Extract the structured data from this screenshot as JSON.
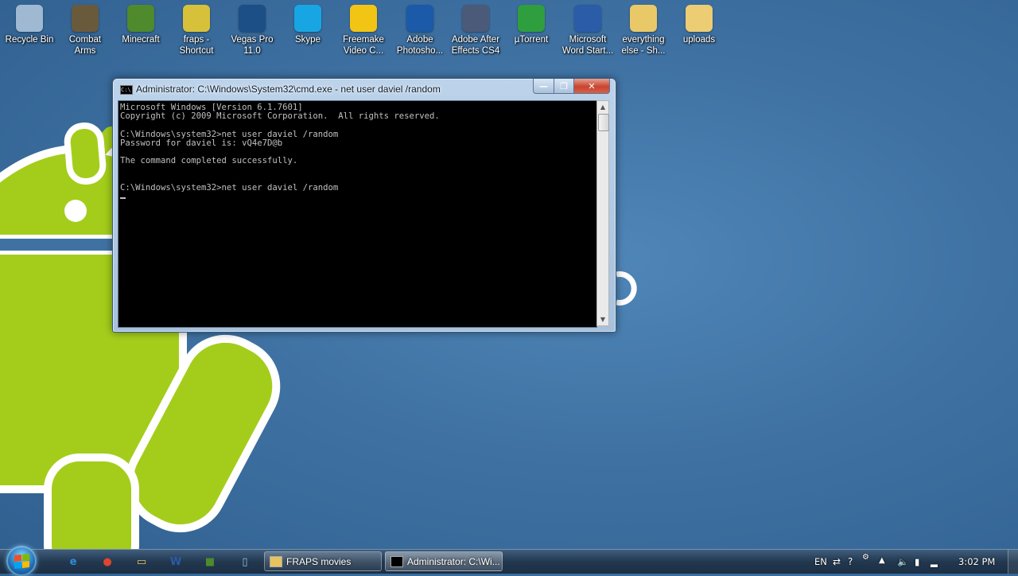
{
  "desktop": {
    "icons": [
      {
        "label": "Recycle Bin",
        "icon": "recycle-bin-icon",
        "color": "#9fb9d3"
      },
      {
        "label": "Combat\nArms",
        "icon": "combat-arms-icon",
        "color": "#6a5a3c"
      },
      {
        "label": "Minecraft",
        "icon": "minecraft-icon",
        "color": "#4f8a2c"
      },
      {
        "label": "fraps -\nShortcut",
        "icon": "fraps-icon",
        "color": "#d8c13a"
      },
      {
        "label": "Vegas Pro\n11.0",
        "icon": "vegas-pro-icon",
        "color": "#1c4f86"
      },
      {
        "label": "Skype",
        "icon": "skype-icon",
        "color": "#17a6e3"
      },
      {
        "label": "Freemake\nVideo C...",
        "icon": "freemake-icon",
        "color": "#f2c414"
      },
      {
        "label": "Adobe\nPhotosho...",
        "icon": "photoshop-icon",
        "color": "#1a5aa8"
      },
      {
        "label": "Adobe After\nEffects CS4",
        "icon": "after-effects-icon",
        "color": "#4a5a78"
      },
      {
        "label": "µTorrent",
        "icon": "utorrent-icon",
        "color": "#2e9e3f"
      },
      {
        "label": "Microsoft\nWord Start...",
        "icon": "word-icon",
        "color": "#2a5ca8"
      },
      {
        "label": "everything\nelse - Sh...",
        "icon": "folder-shortcut-icon",
        "color": "#e9c868"
      },
      {
        "label": "uploads",
        "icon": "folder-icon",
        "color": "#eccd74"
      }
    ]
  },
  "cmd": {
    "title": "Administrator: C:\\Windows\\System32\\cmd.exe - net  user daviel /random",
    "lines": [
      "Microsoft Windows [Version 6.1.7601]",
      "Copyright (c) 2009 Microsoft Corporation.  All rights reserved.",
      "",
      "C:\\Windows\\system32>net user daviel /random",
      "Password for daviel is: vQ4e7D@b",
      "",
      "The command completed successfully.",
      "",
      "",
      "C:\\Windows\\system32>net user daviel /random"
    ],
    "minimize": "—",
    "maximize": "❐",
    "close": "✕"
  },
  "taskbar": {
    "pinned": [
      {
        "icon": "internet-explorer-icon",
        "glyph": "e",
        "color": "#2f8fd8"
      },
      {
        "icon": "chrome-icon",
        "glyph": "●",
        "color": "#e0452e"
      },
      {
        "icon": "explorer-folder-icon",
        "glyph": "▭",
        "color": "#e6c35c"
      },
      {
        "icon": "word-icon",
        "glyph": "W",
        "color": "#2a5ca8"
      },
      {
        "icon": "minecraft-icon",
        "glyph": "■",
        "color": "#4f8a2c"
      },
      {
        "icon": "notepad-icon",
        "glyph": "▯",
        "color": "#8fc3e8"
      }
    ],
    "tasks": [
      {
        "label": "FRAPS movies",
        "icon": "folder-icon"
      },
      {
        "label": "Administrator: C:\\Wi...",
        "icon": "cmd-icon"
      }
    ],
    "tray": {
      "language": "EN",
      "clock": "3:02 PM"
    }
  }
}
